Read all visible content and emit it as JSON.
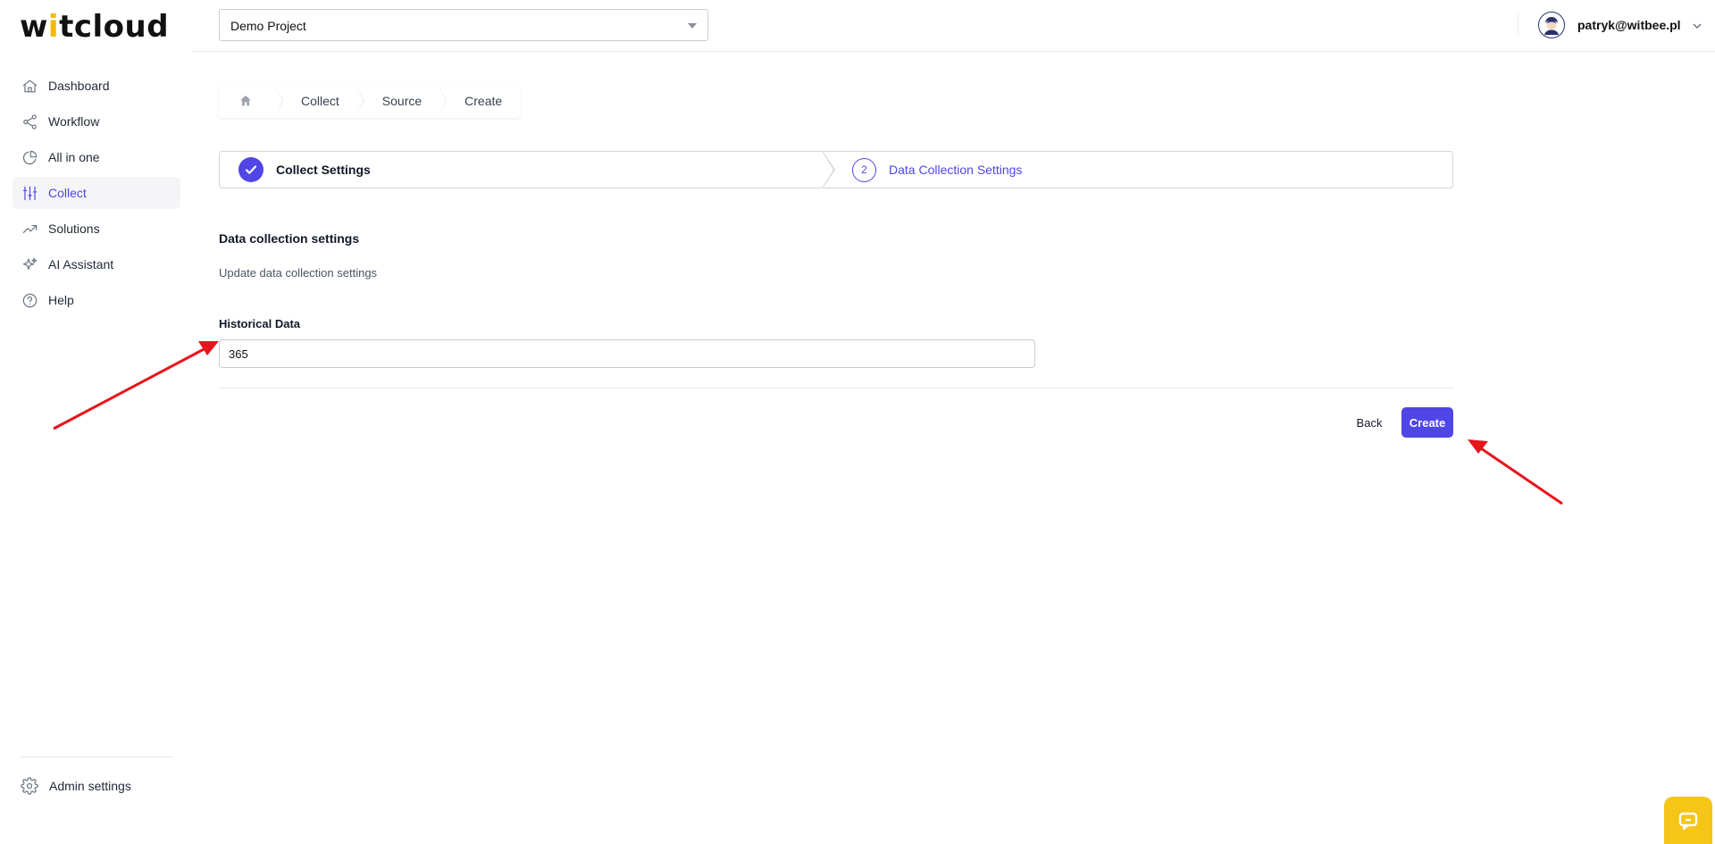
{
  "app": {
    "logo_prefix": "w",
    "logo_slash": "i",
    "logo_suffix": "tcloud",
    "logo_full": "witcloud",
    "accent_color": "#4f46e5",
    "brand_yellow": "#f5c518"
  },
  "sidebar": {
    "items": [
      {
        "label": "Dashboard",
        "icon": "home-icon",
        "active": false
      },
      {
        "label": "Workflow",
        "icon": "share-nodes-icon",
        "active": false
      },
      {
        "label": "All in one",
        "icon": "pie-chart-icon",
        "active": false
      },
      {
        "label": "Collect",
        "icon": "sliders-icon",
        "active": true
      },
      {
        "label": "Solutions",
        "icon": "trending-up-icon",
        "active": false
      },
      {
        "label": "AI Assistant",
        "icon": "sparkles-icon",
        "active": false
      },
      {
        "label": "Help",
        "icon": "question-circle-icon",
        "active": false
      }
    ],
    "admin_label": "Admin settings",
    "admin_icon": "gear-icon"
  },
  "topbar": {
    "project": "Demo Project",
    "user_email": "patryk@witbee.pl"
  },
  "breadcrumb": {
    "home_icon": "home-icon",
    "items": [
      "Collect",
      "Source",
      "Create"
    ]
  },
  "stepper": {
    "steps": [
      {
        "label": "Collect Settings",
        "status": "completed",
        "icon": "check-icon"
      },
      {
        "label": "Data Collection Settings",
        "status": "current",
        "number": "2"
      }
    ]
  },
  "form": {
    "title": "Data collection settings",
    "description": "Update data collection settings",
    "historical_label": "Historical Data",
    "historical_value": "365"
  },
  "actions": {
    "back_label": "Back",
    "create_label": "Create"
  },
  "chat_widget": {
    "icon": "chat-icon"
  }
}
